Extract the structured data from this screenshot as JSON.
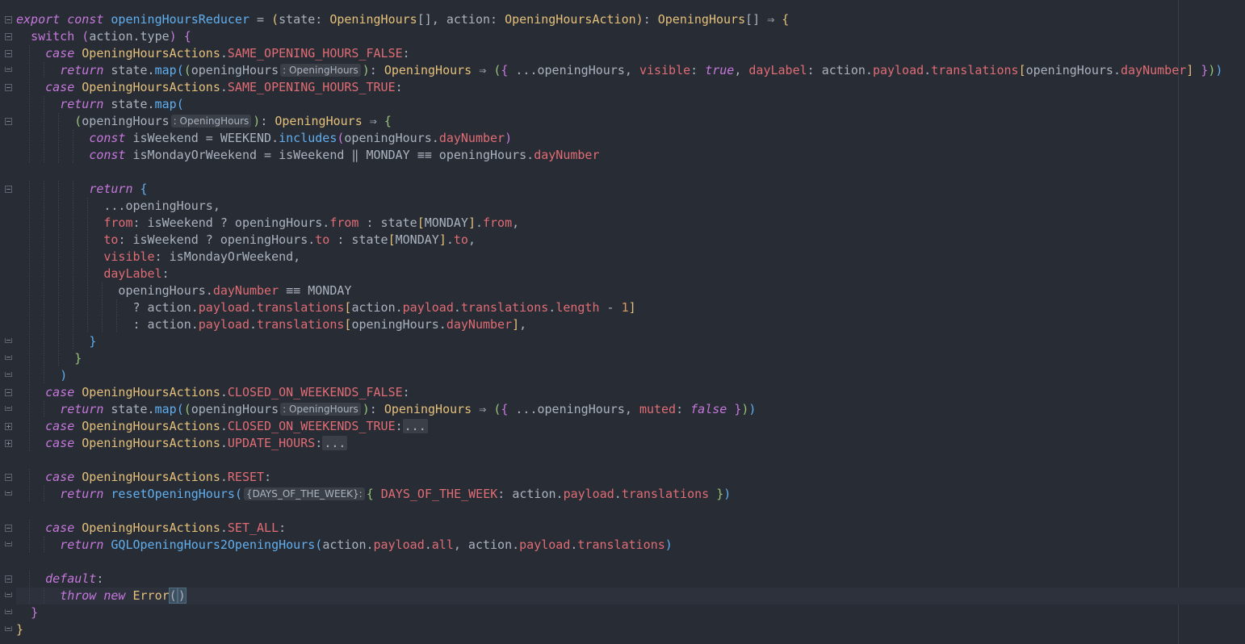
{
  "editor": {
    "language": "TypeScript",
    "theme_colors": {
      "background": "#282c34",
      "keyword": "#c678dd",
      "function": "#61afef",
      "type": "#e5c07b",
      "property": "#e06c75",
      "number": "#d19a66"
    }
  },
  "lines": [
    {
      "current": false,
      "segments": [
        [
          "k",
          "export"
        ],
        [
          "pl",
          " "
        ],
        [
          "k",
          "const"
        ],
        [
          "pl",
          " "
        ],
        [
          "fn",
          "openingHoursReducer"
        ],
        [
          "pl",
          " = "
        ],
        [
          "br1",
          "("
        ],
        [
          "pl",
          "state: "
        ],
        [
          "ty",
          "OpeningHours"
        ],
        [
          "pl",
          "[], action: "
        ],
        [
          "ty",
          "OpeningHoursAction"
        ],
        [
          "br1",
          ")"
        ],
        [
          "pl",
          ": "
        ],
        [
          "ty",
          "OpeningHours"
        ],
        [
          "pl",
          "[] ⇒ "
        ],
        [
          "br1",
          "{"
        ]
      ]
    },
    {
      "current": false,
      "segments": [
        [
          "pl",
          "  "
        ],
        [
          "kn",
          "switch"
        ],
        [
          "pl",
          " "
        ],
        [
          "br2",
          "("
        ],
        [
          "pl",
          "action.type"
        ],
        [
          "br2",
          ")"
        ],
        [
          "pl",
          " "
        ],
        [
          "br2",
          "{"
        ]
      ]
    },
    {
      "current": false,
      "segments": [
        [
          "pl",
          "    "
        ],
        [
          "k",
          "case"
        ],
        [
          "pl",
          " "
        ],
        [
          "ty",
          "OpeningHoursActions"
        ],
        [
          "pl",
          "."
        ],
        [
          "pr",
          "SAME_OPENING_HOURS_FALSE"
        ],
        [
          "pl",
          ":"
        ]
      ]
    },
    {
      "current": false,
      "segments": [
        [
          "pl",
          "      "
        ],
        [
          "k",
          "return"
        ],
        [
          "pl",
          " state."
        ],
        [
          "fn",
          "map"
        ],
        [
          "br3",
          "("
        ],
        [
          "br4",
          "("
        ],
        [
          "pl",
          "openingHours"
        ],
        [
          "hint",
          ": OpeningHours"
        ],
        [
          "br4",
          ")"
        ],
        [
          "pl",
          ": "
        ],
        [
          "ty",
          "OpeningHours"
        ],
        [
          "pl",
          " ⇒ "
        ],
        [
          "br4",
          "("
        ],
        [
          "br2",
          "{"
        ],
        [
          "pl",
          " ...openingHours, "
        ],
        [
          "pr",
          "visible"
        ],
        [
          "pl",
          ": "
        ],
        [
          "bo",
          "true"
        ],
        [
          "pl",
          ", "
        ],
        [
          "pr",
          "dayLabel"
        ],
        [
          "pl",
          ": action."
        ],
        [
          "pr",
          "payload"
        ],
        [
          "pl",
          "."
        ],
        [
          "pr",
          "translations"
        ],
        [
          "br1",
          "["
        ],
        [
          "pl",
          "openingHours."
        ],
        [
          "pr",
          "dayNumber"
        ],
        [
          "br1",
          "]"
        ],
        [
          "pl",
          " "
        ],
        [
          "br2",
          "}"
        ],
        [
          "br4",
          ")"
        ],
        [
          "br3",
          ")"
        ]
      ]
    },
    {
      "current": false,
      "segments": [
        [
          "pl",
          "    "
        ],
        [
          "k",
          "case"
        ],
        [
          "pl",
          " "
        ],
        [
          "ty",
          "OpeningHoursActions"
        ],
        [
          "pl",
          "."
        ],
        [
          "pr",
          "SAME_OPENING_HOURS_TRUE"
        ],
        [
          "pl",
          ":"
        ]
      ]
    },
    {
      "current": false,
      "segments": [
        [
          "pl",
          "      "
        ],
        [
          "k",
          "return"
        ],
        [
          "pl",
          " state."
        ],
        [
          "fn",
          "map"
        ],
        [
          "br3",
          "("
        ]
      ]
    },
    {
      "current": false,
      "segments": [
        [
          "pl",
          "        "
        ],
        [
          "br4",
          "("
        ],
        [
          "pl",
          "openingHours"
        ],
        [
          "hint",
          ": OpeningHours"
        ],
        [
          "br4",
          ")"
        ],
        [
          "pl",
          ": "
        ],
        [
          "ty",
          "OpeningHours"
        ],
        [
          "pl",
          " ⇒ "
        ],
        [
          "br4",
          "{"
        ]
      ]
    },
    {
      "current": false,
      "segments": [
        [
          "pl",
          "          "
        ],
        [
          "k",
          "const"
        ],
        [
          "pl",
          " isWeekend = WEEKEND."
        ],
        [
          "fn",
          "includes"
        ],
        [
          "br2",
          "("
        ],
        [
          "pl",
          "openingHours."
        ],
        [
          "pr",
          "dayNumber"
        ],
        [
          "br2",
          ")"
        ]
      ]
    },
    {
      "current": false,
      "segments": [
        [
          "pl",
          "          "
        ],
        [
          "k",
          "const"
        ],
        [
          "pl",
          " isMondayOrWeekend = isWeekend ‖ MONDAY ≡≡ openingHours."
        ],
        [
          "pr",
          "dayNumber"
        ]
      ]
    },
    {
      "current": false,
      "segments": [
        [
          "pl",
          " "
        ]
      ]
    },
    {
      "current": false,
      "segments": [
        [
          "pl",
          "          "
        ],
        [
          "k",
          "return"
        ],
        [
          "pl",
          " "
        ],
        [
          "br3",
          "{"
        ]
      ]
    },
    {
      "current": false,
      "segments": [
        [
          "pl",
          "            ...openingHours,"
        ]
      ]
    },
    {
      "current": false,
      "segments": [
        [
          "pl",
          "            "
        ],
        [
          "pr",
          "from"
        ],
        [
          "pl",
          ": isWeekend ? openingHours."
        ],
        [
          "pr",
          "from"
        ],
        [
          "pl",
          " : state"
        ],
        [
          "br1",
          "["
        ],
        [
          "pl",
          "MONDAY"
        ],
        [
          "br1",
          "]"
        ],
        [
          "pl",
          "."
        ],
        [
          "pr",
          "from"
        ],
        [
          "pl",
          ","
        ]
      ]
    },
    {
      "current": false,
      "segments": [
        [
          "pl",
          "            "
        ],
        [
          "pr",
          "to"
        ],
        [
          "pl",
          ": isWeekend ? openingHours."
        ],
        [
          "pr",
          "to"
        ],
        [
          "pl",
          " : state"
        ],
        [
          "br1",
          "["
        ],
        [
          "pl",
          "MONDAY"
        ],
        [
          "br1",
          "]"
        ],
        [
          "pl",
          "."
        ],
        [
          "pr",
          "to"
        ],
        [
          "pl",
          ","
        ]
      ]
    },
    {
      "current": false,
      "segments": [
        [
          "pl",
          "            "
        ],
        [
          "pr",
          "visible"
        ],
        [
          "pl",
          ": isMondayOrWeekend,"
        ]
      ]
    },
    {
      "current": false,
      "segments": [
        [
          "pl",
          "            "
        ],
        [
          "pr",
          "dayLabel"
        ],
        [
          "pl",
          ":"
        ]
      ]
    },
    {
      "current": false,
      "segments": [
        [
          "pl",
          "              openingHours."
        ],
        [
          "pr",
          "dayNumber"
        ],
        [
          "pl",
          " ≡≡ MONDAY"
        ]
      ]
    },
    {
      "current": false,
      "segments": [
        [
          "pl",
          "                ? action."
        ],
        [
          "pr",
          "payload"
        ],
        [
          "pl",
          "."
        ],
        [
          "pr",
          "translations"
        ],
        [
          "br1",
          "["
        ],
        [
          "pl",
          "action."
        ],
        [
          "pr",
          "payload"
        ],
        [
          "pl",
          "."
        ],
        [
          "pr",
          "translations"
        ],
        [
          "pl",
          "."
        ],
        [
          "pr",
          "length"
        ],
        [
          "pl",
          " - "
        ],
        [
          "nu",
          "1"
        ],
        [
          "br1",
          "]"
        ]
      ]
    },
    {
      "current": false,
      "segments": [
        [
          "pl",
          "                : action."
        ],
        [
          "pr",
          "payload"
        ],
        [
          "pl",
          "."
        ],
        [
          "pr",
          "translations"
        ],
        [
          "br1",
          "["
        ],
        [
          "pl",
          "openingHours."
        ],
        [
          "pr",
          "dayNumber"
        ],
        [
          "br1",
          "]"
        ],
        [
          "pl",
          ","
        ]
      ]
    },
    {
      "current": false,
      "segments": [
        [
          "pl",
          "          "
        ],
        [
          "br3",
          "}"
        ]
      ]
    },
    {
      "current": false,
      "segments": [
        [
          "pl",
          "        "
        ],
        [
          "br4",
          "}"
        ]
      ]
    },
    {
      "current": false,
      "segments": [
        [
          "pl",
          "      "
        ],
        [
          "br3",
          ")"
        ]
      ]
    },
    {
      "current": false,
      "segments": [
        [
          "pl",
          "    "
        ],
        [
          "k",
          "case"
        ],
        [
          "pl",
          " "
        ],
        [
          "ty",
          "OpeningHoursActions"
        ],
        [
          "pl",
          "."
        ],
        [
          "pr",
          "CLOSED_ON_WEEKENDS_FALSE"
        ],
        [
          "pl",
          ":"
        ]
      ]
    },
    {
      "current": false,
      "segments": [
        [
          "pl",
          "      "
        ],
        [
          "k",
          "return"
        ],
        [
          "pl",
          " state."
        ],
        [
          "fn",
          "map"
        ],
        [
          "br3",
          "("
        ],
        [
          "br4",
          "("
        ],
        [
          "pl",
          "openingHours"
        ],
        [
          "hint",
          ": OpeningHours"
        ],
        [
          "br4",
          ")"
        ],
        [
          "pl",
          ": "
        ],
        [
          "ty",
          "OpeningHours"
        ],
        [
          "pl",
          " ⇒ "
        ],
        [
          "br4",
          "("
        ],
        [
          "br2",
          "{"
        ],
        [
          "pl",
          " ...openingHours, "
        ],
        [
          "pr",
          "muted"
        ],
        [
          "pl",
          ": "
        ],
        [
          "bo",
          "false"
        ],
        [
          "pl",
          " "
        ],
        [
          "br2",
          "}"
        ],
        [
          "br4",
          ")"
        ],
        [
          "br3",
          ")"
        ]
      ]
    },
    {
      "current": false,
      "segments": [
        [
          "pl",
          "    "
        ],
        [
          "k",
          "case"
        ],
        [
          "pl",
          " "
        ],
        [
          "ty",
          "OpeningHoursActions"
        ],
        [
          "pl",
          "."
        ],
        [
          "pr",
          "CLOSED_ON_WEEKENDS_TRUE"
        ],
        [
          "pl",
          ":"
        ],
        [
          "folded",
          "..."
        ]
      ]
    },
    {
      "current": false,
      "segments": [
        [
          "pl",
          "    "
        ],
        [
          "k",
          "case"
        ],
        [
          "pl",
          " "
        ],
        [
          "ty",
          "OpeningHoursActions"
        ],
        [
          "pl",
          "."
        ],
        [
          "pr",
          "UPDATE_HOURS"
        ],
        [
          "pl",
          ":"
        ],
        [
          "folded",
          "..."
        ]
      ]
    },
    {
      "current": false,
      "segments": [
        [
          "pl",
          " "
        ]
      ]
    },
    {
      "current": false,
      "segments": [
        [
          "pl",
          "    "
        ],
        [
          "k",
          "case"
        ],
        [
          "pl",
          " "
        ],
        [
          "ty",
          "OpeningHoursActions"
        ],
        [
          "pl",
          "."
        ],
        [
          "pr",
          "RESET"
        ],
        [
          "pl",
          ":"
        ]
      ]
    },
    {
      "current": false,
      "segments": [
        [
          "pl",
          "      "
        ],
        [
          "k",
          "return"
        ],
        [
          "pl",
          " "
        ],
        [
          "fn",
          "resetOpeningHours"
        ],
        [
          "br3",
          "("
        ],
        [
          "hint",
          "{DAYS_OF_THE_WEEK}:"
        ],
        [
          "br4",
          "{"
        ],
        [
          "pl",
          " "
        ],
        [
          "pr",
          "DAYS_OF_THE_WEEK"
        ],
        [
          "pl",
          ": action."
        ],
        [
          "pr",
          "payload"
        ],
        [
          "pl",
          "."
        ],
        [
          "pr",
          "translations"
        ],
        [
          "pl",
          " "
        ],
        [
          "br4",
          "}"
        ],
        [
          "br3",
          ")"
        ]
      ]
    },
    {
      "current": false,
      "segments": [
        [
          "pl",
          " "
        ]
      ]
    },
    {
      "current": false,
      "segments": [
        [
          "pl",
          "    "
        ],
        [
          "k",
          "case"
        ],
        [
          "pl",
          " "
        ],
        [
          "ty",
          "OpeningHoursActions"
        ],
        [
          "pl",
          "."
        ],
        [
          "pr",
          "SET_ALL"
        ],
        [
          "pl",
          ":"
        ]
      ]
    },
    {
      "current": false,
      "segments": [
        [
          "pl",
          "      "
        ],
        [
          "k",
          "return"
        ],
        [
          "pl",
          " "
        ],
        [
          "fn",
          "GQLOpeningHours2OpeningHours"
        ],
        [
          "br3",
          "("
        ],
        [
          "pl",
          "action."
        ],
        [
          "pr",
          "payload"
        ],
        [
          "pl",
          "."
        ],
        [
          "pr",
          "all"
        ],
        [
          "pl",
          ", action."
        ],
        [
          "pr",
          "payload"
        ],
        [
          "pl",
          "."
        ],
        [
          "pr",
          "translations"
        ],
        [
          "br3",
          ")"
        ]
      ]
    },
    {
      "current": false,
      "segments": [
        [
          "pl",
          " "
        ]
      ]
    },
    {
      "current": false,
      "segments": [
        [
          "pl",
          "    "
        ],
        [
          "k",
          "default"
        ],
        [
          "pl",
          ":"
        ]
      ]
    },
    {
      "current": true,
      "segments": [
        [
          "pl",
          "      "
        ],
        [
          "k",
          "throw"
        ],
        [
          "pl",
          " "
        ],
        [
          "k",
          "new"
        ],
        [
          "pl",
          " "
        ],
        [
          "ty",
          "Error"
        ],
        [
          "caret-match",
          "("
        ],
        [
          "caret",
          ""
        ],
        [
          "caret-match",
          ")"
        ]
      ]
    },
    {
      "current": false,
      "segments": [
        [
          "pl",
          "  "
        ],
        [
          "br2",
          "}"
        ]
      ]
    },
    {
      "current": false,
      "segments": [
        [
          "br1",
          "}"
        ]
      ]
    }
  ],
  "folds": [
    {
      "line": 0,
      "kind": "open"
    },
    {
      "line": 1,
      "kind": "open"
    },
    {
      "line": 2,
      "kind": "open"
    },
    {
      "line": 3,
      "kind": "end"
    },
    {
      "line": 4,
      "kind": "open"
    },
    {
      "line": 6,
      "kind": "open"
    },
    {
      "line": 10,
      "kind": "open"
    },
    {
      "line": 19,
      "kind": "end"
    },
    {
      "line": 20,
      "kind": "end"
    },
    {
      "line": 21,
      "kind": "end"
    },
    {
      "line": 22,
      "kind": "open"
    },
    {
      "line": 23,
      "kind": "end"
    },
    {
      "line": 24,
      "kind": "collapsed"
    },
    {
      "line": 25,
      "kind": "collapsed"
    },
    {
      "line": 27,
      "kind": "open"
    },
    {
      "line": 28,
      "kind": "end"
    },
    {
      "line": 30,
      "kind": "open"
    },
    {
      "line": 31,
      "kind": "end"
    },
    {
      "line": 33,
      "kind": "open"
    },
    {
      "line": 34,
      "kind": "end"
    },
    {
      "line": 35,
      "kind": "end"
    },
    {
      "line": 36,
      "kind": "end"
    }
  ]
}
